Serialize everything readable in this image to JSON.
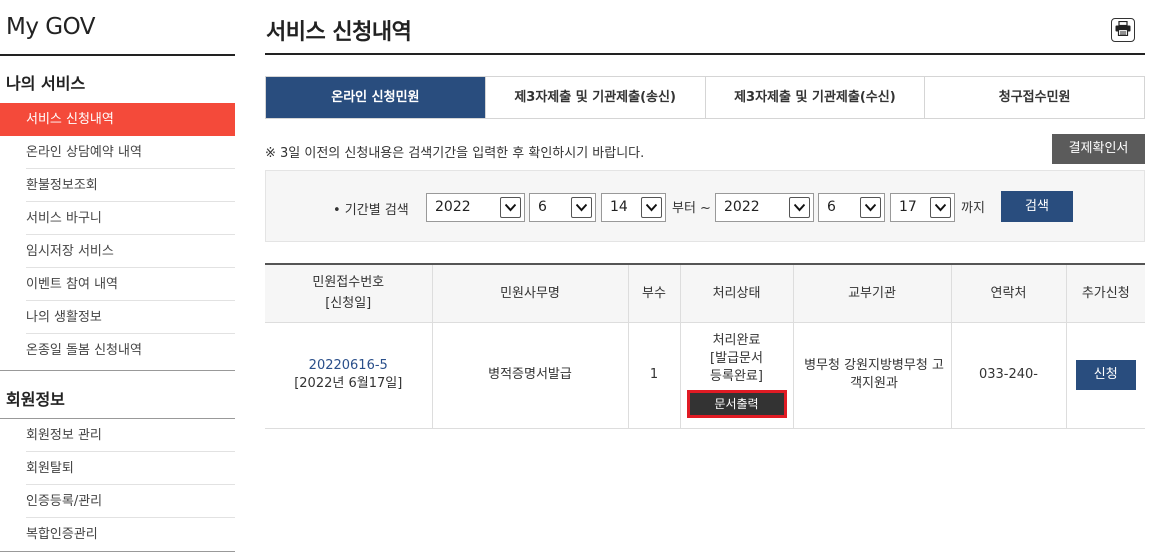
{
  "sidebar": {
    "brand": "My GOV",
    "section1_title": "나의 서비스",
    "section1_items": [
      {
        "label": "서비스 신청내역",
        "active": true
      },
      {
        "label": "온라인 상담예약 내역"
      },
      {
        "label": "환불정보조회"
      },
      {
        "label": "서비스 바구니"
      },
      {
        "label": "임시저장 서비스"
      },
      {
        "label": "이벤트 참여 내역"
      },
      {
        "label": "나의 생활정보"
      },
      {
        "label": "온종일 돌봄 신청내역"
      }
    ],
    "section2_title": "회원정보",
    "section2_items": [
      {
        "label": "회원정보 관리"
      },
      {
        "label": "회원탈퇴"
      },
      {
        "label": "인증등록/관리"
      },
      {
        "label": "복합인증관리"
      }
    ]
  },
  "main": {
    "title": "서비스 신청내역",
    "print_icon": "printer-icon",
    "tabs": [
      {
        "label": "온라인 신청민원",
        "active": true
      },
      {
        "label": "제3자제출 및 기관제출(송신)"
      },
      {
        "label": "제3자제출 및 기관제출(수신)"
      },
      {
        "label": "청구접수민원"
      }
    ],
    "notice": "※ 3일 이전의 신청내용은 검색기간을 입력한 후 확인하시기 바랍니다.",
    "receipt_button": "결제확인서",
    "search": {
      "label": "• 기간별 검색",
      "from_year": "2022",
      "from_month": "6",
      "from_day": "14",
      "from_suffix": "부터 ~",
      "to_year": "2022",
      "to_month": "6",
      "to_day": "17",
      "to_suffix": "까지",
      "button": "검색"
    },
    "table": {
      "headers": {
        "receipt_no_line1": "민원접수번호",
        "receipt_no_line2": "[신청일]",
        "name": "민원사무명",
        "copies": "부수",
        "status": "처리상태",
        "agency": "교부기관",
        "contact": "연락처",
        "extra": "추가신청"
      },
      "rows": [
        {
          "receipt_no": "20220616-5",
          "date": "[2022년 6월17일]",
          "name": "병적증명서발급",
          "copies": "1",
          "status_line1": "처리완료",
          "status_line2": "[발급문서",
          "status_line3": "등록완료]",
          "status_button": "문서출력",
          "agency": "병무청 강원지방병무청 고객지원과",
          "contact": "033-240-",
          "extra_button": "신청"
        }
      ]
    }
  }
}
